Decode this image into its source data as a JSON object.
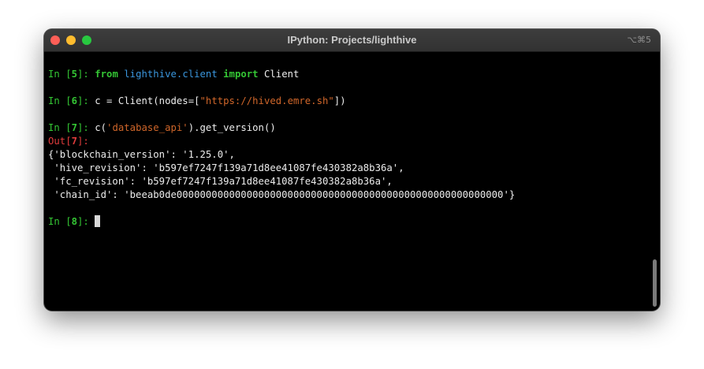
{
  "window": {
    "title": "IPython: Projects/lighthive",
    "shortcut": "⌥⌘5"
  },
  "terminal": {
    "cell5": {
      "in_prefix": "In [",
      "num": "5",
      "in_suffix": "]: ",
      "kw_from": "from",
      "module": "lighthive.client",
      "kw_import": "import",
      "name": "Client"
    },
    "cell6": {
      "in_prefix": "In [",
      "num": "6",
      "in_suffix": "]: ",
      "code_a": "c = Client(nodes=[",
      "string": "\"https://hived.emre.sh\"",
      "code_b": "])"
    },
    "cell7": {
      "in_prefix": "In [",
      "num": "7",
      "in_suffix": "]: ",
      "code_a": "c(",
      "string": "'database_api'",
      "code_b": ").get_version()",
      "out_prefix": "Out[",
      "out_num": "7",
      "out_suffix": "]:"
    },
    "output": [
      "{'blockchain_version': '1.25.0',",
      " 'hive_revision': 'b597ef7247f139a71d8ee41087fe430382a8b36a',",
      " 'fc_revision': 'b597ef7247f139a71d8ee41087fe430382a8b36a',",
      " 'chain_id': 'beeab0de00000000000000000000000000000000000000000000000000000000'}"
    ],
    "cell8": {
      "in_prefix": "In [",
      "num": "8",
      "in_suffix": "]: "
    }
  },
  "colors": {
    "prompt_in": "#34c534",
    "prompt_out": "#e03c3c",
    "module": "#3a96dd",
    "string": "#d0662a",
    "background": "#000000"
  },
  "icons": [
    "close-button",
    "minimize-button",
    "zoom-button",
    "text-cursor"
  ]
}
